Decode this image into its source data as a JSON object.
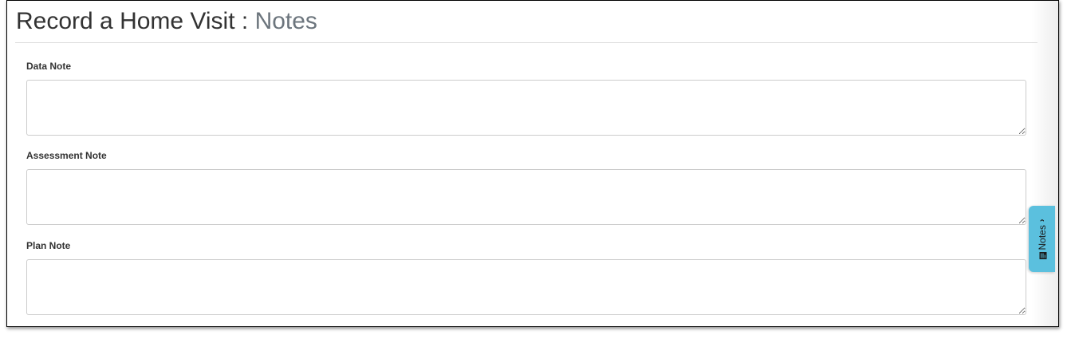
{
  "page": {
    "title_main": "Record a Home Visit : ",
    "title_section": "Notes"
  },
  "form": {
    "data_note": {
      "label": "Data Note",
      "value": ""
    },
    "assessment_note": {
      "label": "Assessment Note",
      "value": ""
    },
    "plan_note": {
      "label": "Plan Note",
      "value": ""
    }
  },
  "notes_tab": {
    "label": "Notes",
    "icon": "note-icon",
    "chevron": "›",
    "color": "#5bc0de"
  }
}
